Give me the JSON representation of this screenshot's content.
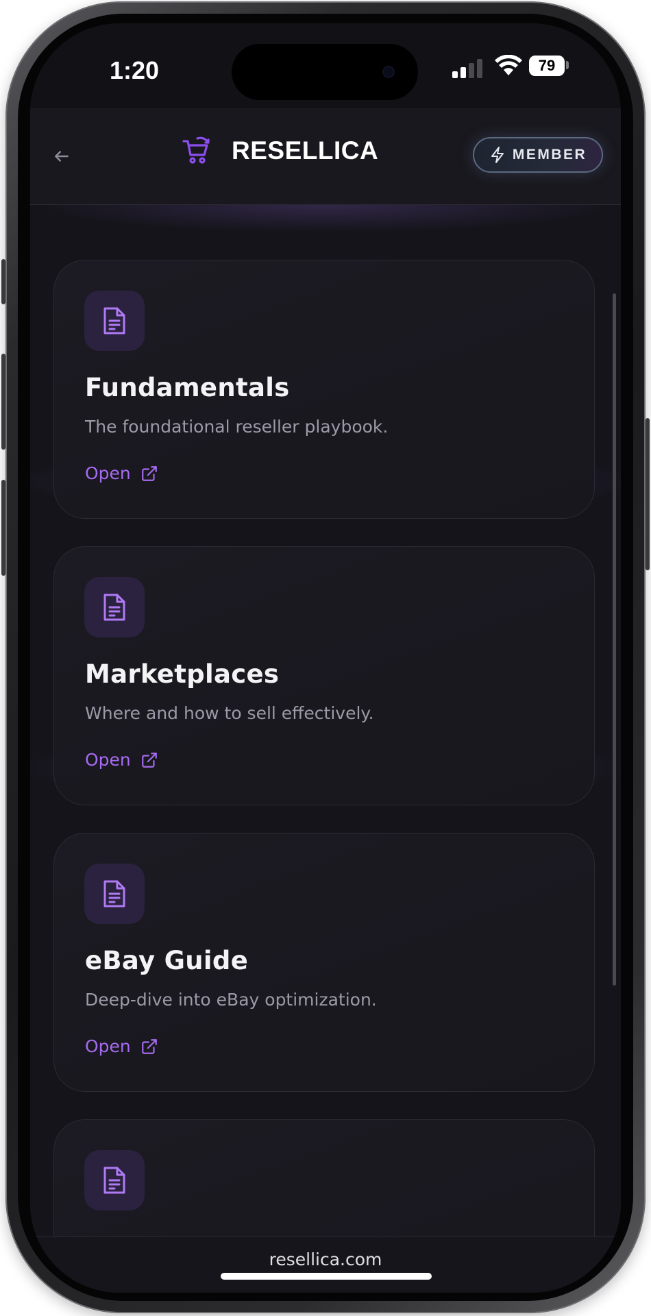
{
  "status_bar": {
    "time": "1:20",
    "battery": "79"
  },
  "header": {
    "brand_name": "RESELLICA",
    "member_label": "MEMBER"
  },
  "cards": [
    {
      "title": "Fundamentals",
      "description": "The foundational reseller playbook.",
      "link_label": "Open"
    },
    {
      "title": "Marketplaces",
      "description": "Where and how to sell effectively.",
      "link_label": "Open"
    },
    {
      "title": "eBay Guide",
      "description": "Deep-dive into eBay optimization.",
      "link_label": "Open"
    },
    {
      "title": "",
      "description": "",
      "link_label": ""
    }
  ],
  "footer": {
    "url": "resellica.com"
  },
  "colors": {
    "accent": "#a66bf0",
    "background": "#15141a",
    "card": "#1c1a22"
  }
}
